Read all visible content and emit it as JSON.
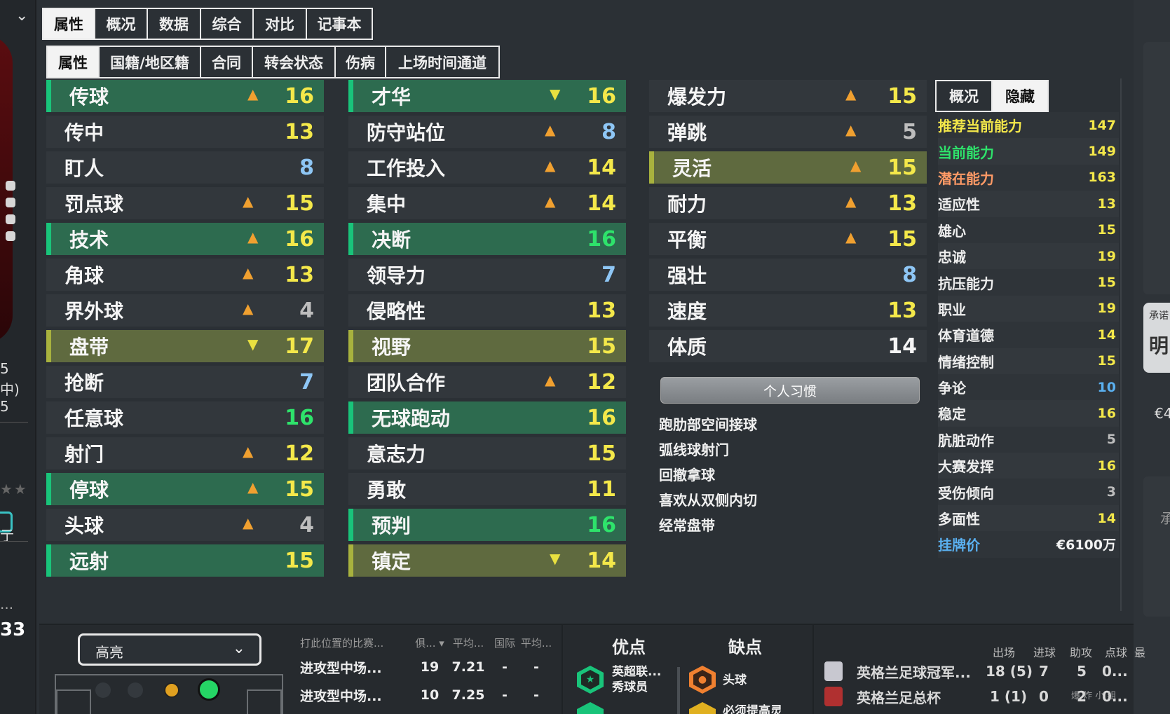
{
  "main_tabs": [
    "属性",
    "概况",
    "数据",
    "综合",
    "对比",
    "记事本"
  ],
  "sub_tabs": [
    "属性",
    "国籍/地区籍",
    "合同",
    "转会状态",
    "伤病",
    "上场时间通道"
  ],
  "col1": [
    {
      "name": "传球",
      "value": "16",
      "style": "green",
      "arrow": "up",
      "val_color": "yellow"
    },
    {
      "name": "传中",
      "value": "13",
      "style": "plain",
      "arrow": "",
      "val_color": "yellow"
    },
    {
      "name": "盯人",
      "value": "8",
      "style": "plain",
      "arrow": "",
      "val_color": "blue"
    },
    {
      "name": "罚点球",
      "value": "15",
      "style": "plain",
      "arrow": "up",
      "val_color": "yellow"
    },
    {
      "name": "技术",
      "value": "16",
      "style": "green",
      "arrow": "up",
      "val_color": "yellow"
    },
    {
      "name": "角球",
      "value": "13",
      "style": "plain",
      "arrow": "up",
      "val_color": "yellow"
    },
    {
      "name": "界外球",
      "value": "4",
      "style": "plain",
      "arrow": "up",
      "val_color": "grey"
    },
    {
      "name": "盘带",
      "value": "17",
      "style": "olive",
      "arrow": "down",
      "val_color": "yellow"
    },
    {
      "name": "抢断",
      "value": "7",
      "style": "plain",
      "arrow": "",
      "val_color": "blue"
    },
    {
      "name": "任意球",
      "value": "16",
      "style": "plain",
      "arrow": "",
      "val_color": "green"
    },
    {
      "name": "射门",
      "value": "12",
      "style": "plain",
      "arrow": "up",
      "val_color": "yellow"
    },
    {
      "name": "停球",
      "value": "15",
      "style": "green",
      "arrow": "up",
      "val_color": "yellow"
    },
    {
      "name": "头球",
      "value": "4",
      "style": "plain",
      "arrow": "up",
      "val_color": "grey"
    },
    {
      "name": "远射",
      "value": "15",
      "style": "green",
      "arrow": "",
      "val_color": "yellow"
    }
  ],
  "col2": [
    {
      "name": "才华",
      "value": "16",
      "style": "green",
      "arrow": "down",
      "val_color": "yellow"
    },
    {
      "name": "防守站位",
      "value": "8",
      "style": "plain",
      "arrow": "up",
      "val_color": "blue"
    },
    {
      "name": "工作投入",
      "value": "14",
      "style": "plain",
      "arrow": "up",
      "val_color": "yellow"
    },
    {
      "name": "集中",
      "value": "14",
      "style": "plain",
      "arrow": "up",
      "val_color": "yellow"
    },
    {
      "name": "决断",
      "value": "16",
      "style": "green",
      "arrow": "",
      "val_color": "green"
    },
    {
      "name": "领导力",
      "value": "7",
      "style": "plain",
      "arrow": "",
      "val_color": "blue"
    },
    {
      "name": "侵略性",
      "value": "13",
      "style": "plain",
      "arrow": "",
      "val_color": "yellow"
    },
    {
      "name": "视野",
      "value": "15",
      "style": "olive",
      "arrow": "",
      "val_color": "yellow"
    },
    {
      "name": "团队合作",
      "value": "12",
      "style": "plain",
      "arrow": "up",
      "val_color": "yellow"
    },
    {
      "name": "无球跑动",
      "value": "16",
      "style": "green",
      "arrow": "",
      "val_color": "yellow"
    },
    {
      "name": "意志力",
      "value": "15",
      "style": "plain",
      "arrow": "",
      "val_color": "yellow"
    },
    {
      "name": "勇敢",
      "value": "11",
      "style": "plain",
      "arrow": "",
      "val_color": "yellow"
    },
    {
      "name": "预判",
      "value": "16",
      "style": "green",
      "arrow": "",
      "val_color": "green"
    },
    {
      "name": "镇定",
      "value": "14",
      "style": "olive",
      "arrow": "down",
      "val_color": "yellow"
    }
  ],
  "col3": [
    {
      "name": "爆发力",
      "value": "15",
      "style": "plain",
      "arrow": "up",
      "val_color": "yellow"
    },
    {
      "name": "弹跳",
      "value": "5",
      "style": "plain",
      "arrow": "up",
      "val_color": "grey"
    },
    {
      "name": "灵活",
      "value": "15",
      "style": "olive",
      "arrow": "up",
      "val_color": "yellow"
    },
    {
      "name": "耐力",
      "value": "13",
      "style": "plain",
      "arrow": "up",
      "val_color": "yellow"
    },
    {
      "name": "平衡",
      "value": "15",
      "style": "plain",
      "arrow": "up",
      "val_color": "yellow"
    },
    {
      "name": "强壮",
      "value": "8",
      "style": "plain",
      "arrow": "",
      "val_color": "blue"
    },
    {
      "name": "速度",
      "value": "13",
      "style": "plain",
      "arrow": "",
      "val_color": "yellow"
    },
    {
      "name": "体质",
      "value": "14",
      "style": "plain",
      "arrow": "",
      "val_color": "white"
    }
  ],
  "habits": {
    "header": "个人习惯",
    "items": [
      "跑肋部空间接球",
      "弧线球射门",
      "回撤拿球",
      "喜欢从双侧内切",
      "经常盘带"
    ]
  },
  "right_tabs": [
    "概况",
    "隐藏"
  ],
  "hidden": [
    {
      "label": "推荐当前能力",
      "value": "147",
      "label_color": "yellow",
      "val_color": "yellow"
    },
    {
      "label": "当前能力",
      "value": "149",
      "label_color": "green",
      "val_color": "yellow"
    },
    {
      "label": "潜在能力",
      "value": "163",
      "label_color": "orange",
      "val_color": "yellow"
    },
    {
      "label": "适应性",
      "value": "13",
      "label_color": "",
      "val_color": "yellow"
    },
    {
      "label": "雄心",
      "value": "15",
      "label_color": "",
      "val_color": "yellow"
    },
    {
      "label": "忠诚",
      "value": "19",
      "label_color": "",
      "val_color": "yellow"
    },
    {
      "label": "抗压能力",
      "value": "15",
      "label_color": "",
      "val_color": "yellow"
    },
    {
      "label": "职业",
      "value": "19",
      "label_color": "",
      "val_color": "yellow"
    },
    {
      "label": "体育道德",
      "value": "14",
      "label_color": "",
      "val_color": "yellow"
    },
    {
      "label": "情绪控制",
      "value": "15",
      "label_color": "",
      "val_color": "yellow"
    },
    {
      "label": "争论",
      "value": "10",
      "label_color": "",
      "val_color": "blue"
    },
    {
      "label": "稳定",
      "value": "16",
      "label_color": "",
      "val_color": "yellow"
    },
    {
      "label": "肮脏动作",
      "value": "5",
      "label_color": "",
      "val_color": "grey"
    },
    {
      "label": "大赛发挥",
      "value": "16",
      "label_color": "",
      "val_color": "yellow"
    },
    {
      "label": "受伤倾向",
      "value": "3",
      "label_color": "",
      "val_color": "grey"
    },
    {
      "label": "多面性",
      "value": "14",
      "label_color": "",
      "val_color": "yellow"
    },
    {
      "label": "挂牌价",
      "value": "€6100万",
      "label_color": "blue",
      "val_color": "white"
    }
  ],
  "left_strip": {
    "lines": [
      "5",
      "中)",
      "5"
    ],
    "bottom_value": "33",
    "bottom_dots": "...",
    "small": "亍"
  },
  "far_right": {
    "card_small": "承诺",
    "card_big": "明",
    "euro": "€4",
    "cheng": "承"
  },
  "bottom": {
    "highlight_label": "高亮",
    "pos_table": {
      "headers": [
        "打此位置的比赛...",
        "俱... ▾",
        "平均...",
        "国际",
        "平均..."
      ],
      "rows": [
        [
          "进攻型中场...",
          "19",
          "7.21",
          "-",
          "-"
        ],
        [
          "进攻型中场...",
          "10",
          "7.25",
          "-",
          "-"
        ]
      ]
    },
    "pros_title": "优点",
    "cons_title": "缺点",
    "pros": [
      {
        "text": "英超联...\n秀球员",
        "icon": "star-badge-icon"
      }
    ],
    "cons": [
      {
        "text": "头球",
        "icon": "header-badge-icon"
      },
      {
        "text": "必须提高灵",
        "icon": "warning-badge-icon"
      }
    ],
    "history": {
      "headers": [
        "出场",
        "进球",
        "助攻",
        "点球",
        "最"
      ],
      "rows": [
        {
          "name": "英格兰足球冠军...",
          "apps": "18 (5)",
          "goals": "7",
          "assists": "5",
          "pens": "0..."
        },
        {
          "name": "英格兰足总杯",
          "apps": "1 (1)",
          "goals": "0",
          "assists": "2",
          "pens": "0..."
        }
      ]
    },
    "watermark": "爆 炸 小 组"
  },
  "colors": {
    "green_row": "#2d6b4f",
    "olive_row": "#5f6a3f",
    "yellow": "#f4e84a",
    "green": "#2ee36b",
    "blue": "#8ec6f5"
  }
}
